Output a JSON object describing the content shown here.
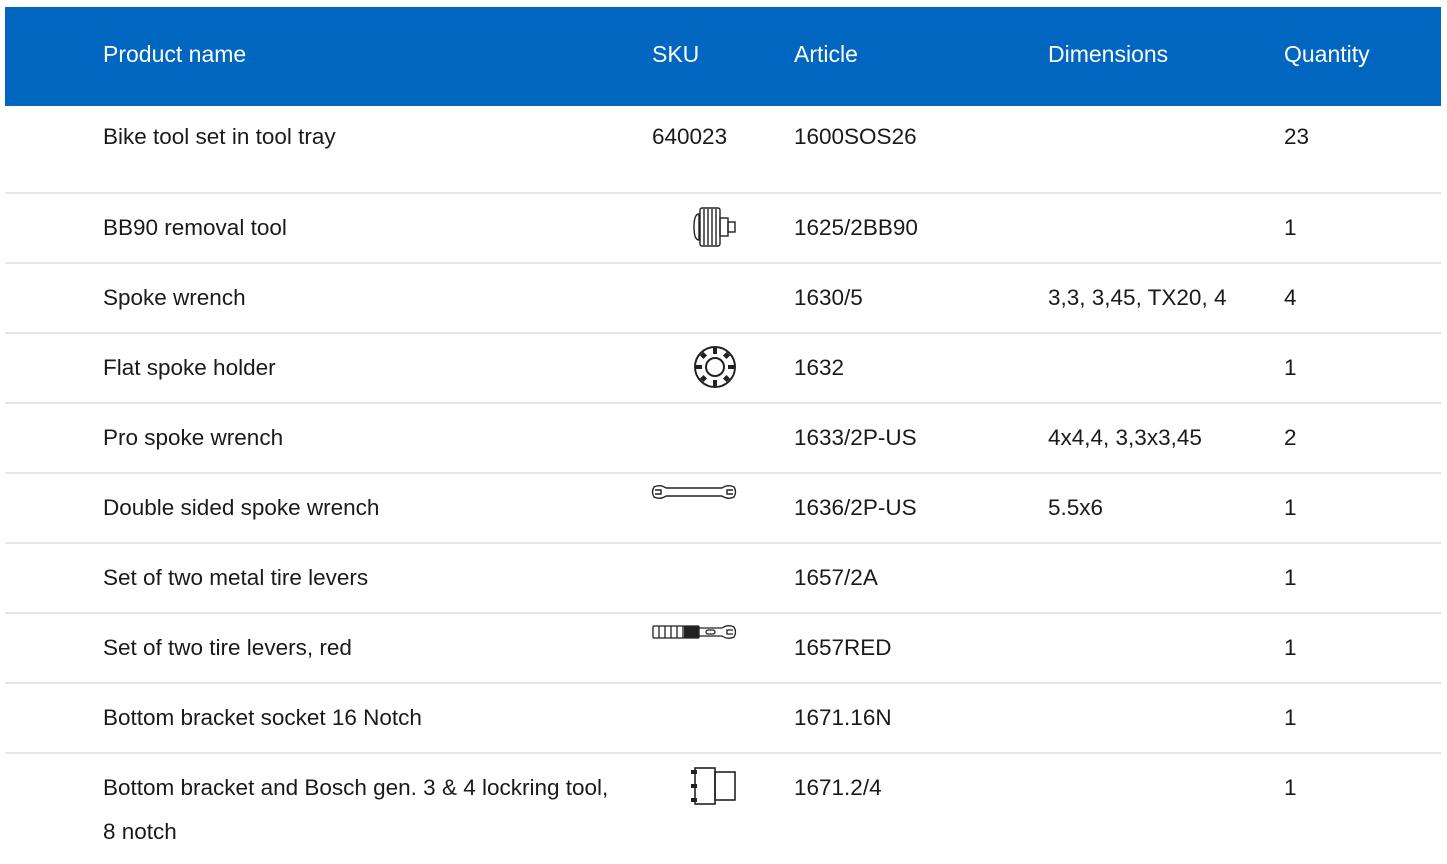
{
  "header": {
    "product_name": "Product name",
    "sku": "SKU",
    "article": "Article",
    "dimensions": "Dimensions",
    "quantity": "Quantity"
  },
  "colors": {
    "header_bg": "#0066bf",
    "header_text": "#ffffff",
    "row_divider": "#e6e6e6"
  },
  "rows": [
    {
      "name": "Bike tool set in tool tray",
      "sku": "640023",
      "sku_icon": "",
      "article": "1600SOS26",
      "dimensions": "",
      "quantity": "23"
    },
    {
      "name": "BB90 removal tool",
      "sku": "",
      "sku_icon": "bb90-removal-tool-icon",
      "article": "1625/2BB90",
      "dimensions": "",
      "quantity": "1"
    },
    {
      "name": "Spoke wrench",
      "sku": "",
      "sku_icon": "",
      "article": "1630/5",
      "dimensions": "3,3, 3,45, TX20, 4",
      "quantity": "4"
    },
    {
      "name": "Flat spoke holder",
      "sku": "",
      "sku_icon": "flat-spoke-holder-icon",
      "article": "1632",
      "dimensions": "",
      "quantity": "1"
    },
    {
      "name": "Pro spoke wrench",
      "sku": "",
      "sku_icon": "",
      "article": "1633/2P-US",
      "dimensions": "4x4,4, 3,3x3,45",
      "quantity": "2"
    },
    {
      "name": "Double sided spoke wrench",
      "sku": "",
      "sku_icon": "double-sided-spoke-wrench-icon",
      "article": "1636/2P-US",
      "dimensions": "5.5x6",
      "quantity": "1"
    },
    {
      "name": "Set of two metal tire levers",
      "sku": "",
      "sku_icon": "",
      "article": "1657/2A",
      "dimensions": "",
      "quantity": "1"
    },
    {
      "name": "Set of two tire levers, red",
      "sku": "",
      "sku_icon": "tire-lever-icon",
      "article": "1657RED",
      "dimensions": "",
      "quantity": "1"
    },
    {
      "name": "Bottom bracket socket 16 Notch",
      "sku": "",
      "sku_icon": "",
      "article": "1671.16N",
      "dimensions": "",
      "quantity": "1"
    },
    {
      "name": "Bottom bracket and Bosch gen. 3 & 4 lockring tool, 8 notch",
      "sku": "",
      "sku_icon": "bottom-bracket-socket-icon",
      "article": "1671.2/4",
      "dimensions": "",
      "quantity": "1"
    }
  ]
}
